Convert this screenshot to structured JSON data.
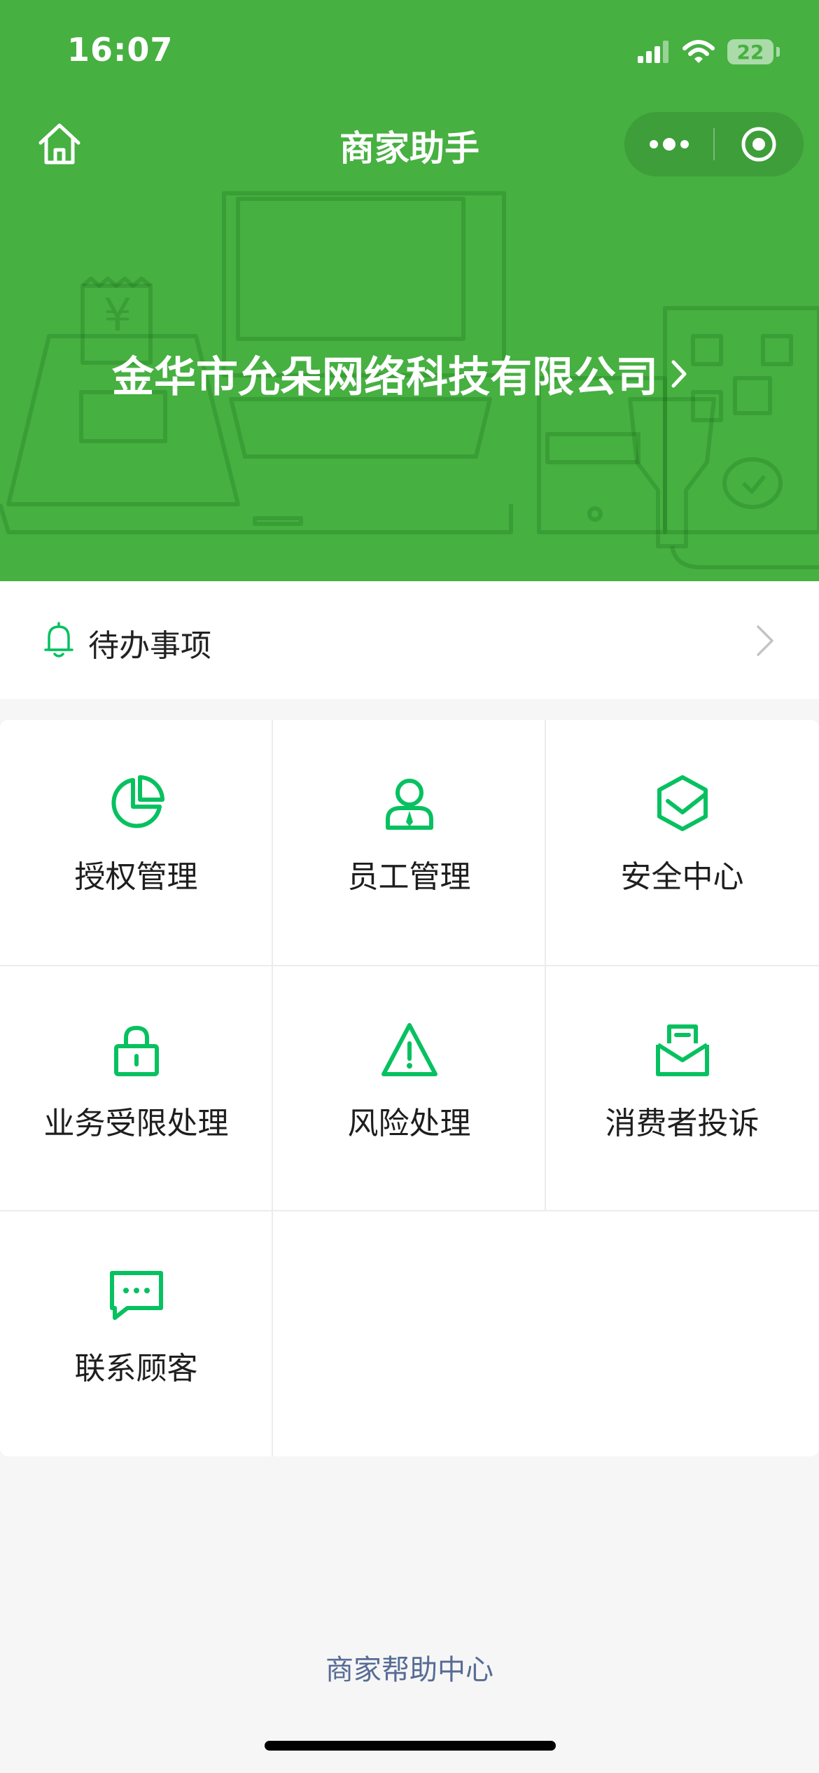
{
  "status_bar": {
    "time": "16:07",
    "battery": "22"
  },
  "nav": {
    "title": "商家助手",
    "home_icon": "home-icon",
    "more_icon": "more-dots-icon",
    "close_icon": "target-circle-icon"
  },
  "company": {
    "name": "金华市允朵网络科技有限公司",
    "chevron": "›"
  },
  "todo": {
    "label": "待办事项",
    "icon": "bell-icon"
  },
  "menu": {
    "items": [
      {
        "label": "授权管理",
        "icon": "pie-chart-icon"
      },
      {
        "label": "员工管理",
        "icon": "employee-icon"
      },
      {
        "label": "安全中心",
        "icon": "shield-icon"
      },
      {
        "label": "业务受限处理",
        "icon": "lock-icon"
      },
      {
        "label": "风险处理",
        "icon": "warning-icon"
      },
      {
        "label": "消费者投诉",
        "icon": "mail-icon"
      },
      {
        "label": "联系顾客",
        "icon": "chat-icon"
      }
    ]
  },
  "footer": {
    "help_link": "商家帮助中心"
  },
  "colors": {
    "header_green": "#46b041",
    "icon_green": "#07c160",
    "link_blue": "#576b95"
  }
}
